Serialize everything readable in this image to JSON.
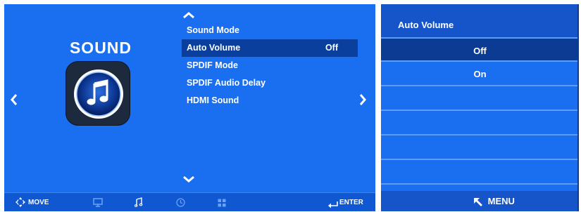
{
  "left_panel": {
    "title": "SOUND",
    "menu_items": [
      {
        "label": "Sound Mode",
        "value": "",
        "selected": false
      },
      {
        "label": "Auto Volume",
        "value": "Off",
        "selected": true
      },
      {
        "label": "SPDIF Mode",
        "value": "",
        "selected": false
      },
      {
        "label": "SPDIF Audio Delay",
        "value": "",
        "selected": false
      },
      {
        "label": "HDMI Sound",
        "value": "",
        "selected": false
      }
    ],
    "bottom_bar": {
      "move_label": "MOVE",
      "enter_label": "ENTER",
      "tab_icons": [
        "picture-icon",
        "sound-icon",
        "time-icon",
        "setup-icon"
      ],
      "active_tab": "sound-icon"
    },
    "icons": {
      "app": "music-note-icon",
      "nav_left": "chevron-left-icon",
      "nav_right": "chevron-right-icon",
      "scroll_up": "chevron-up-icon",
      "scroll_down": "chevron-down-icon",
      "move": "directional-pad-icon",
      "enter": "enter-icon"
    }
  },
  "right_panel": {
    "title": "Auto Volume",
    "options": [
      {
        "label": "Off",
        "selected": true
      },
      {
        "label": "On",
        "selected": false
      },
      {
        "label": "",
        "selected": false
      },
      {
        "label": "",
        "selected": false
      },
      {
        "label": "",
        "selected": false
      },
      {
        "label": "",
        "selected": false
      }
    ],
    "footer": {
      "menu_label": "MENU",
      "menu_icon": "back-arrow-icon"
    }
  },
  "colors": {
    "panel_blue": "#1a6ff0",
    "selected_blue": "#0b3f9e",
    "bar_blue": "#1057d2",
    "text": "#ffffff",
    "dimmed_icon": "#6aa3f5"
  }
}
